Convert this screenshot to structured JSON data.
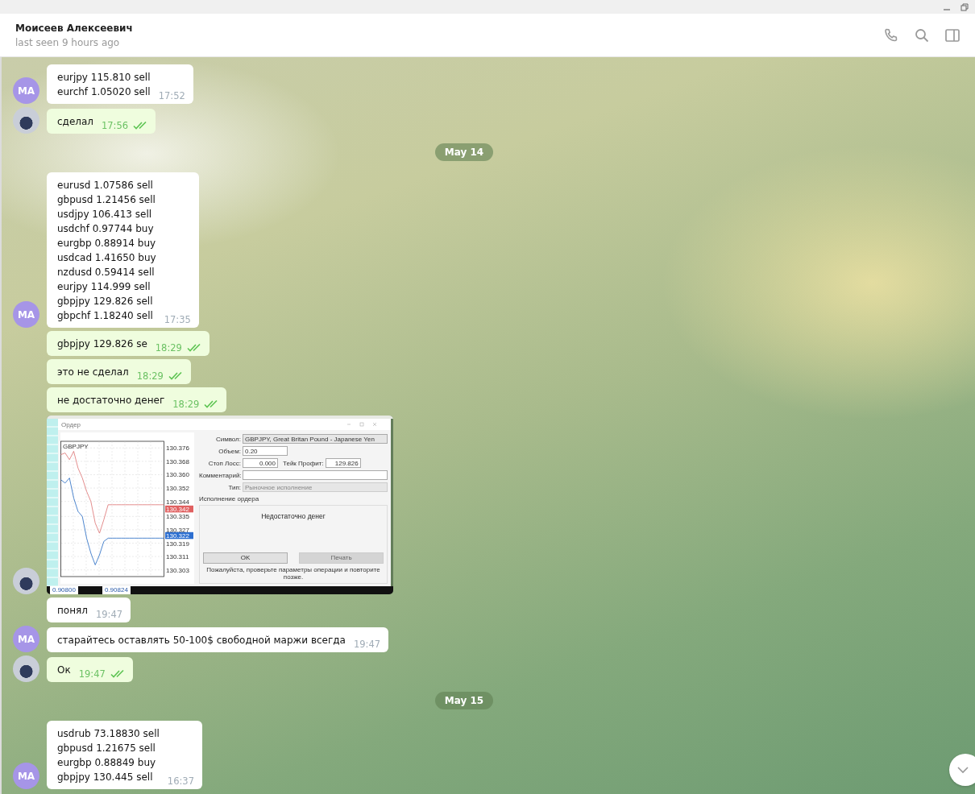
{
  "header": {
    "name": "Моисеев Алексеевич",
    "status": "last seen 9 hours ago"
  },
  "messages": [
    {
      "kind": "message",
      "outgoing": false,
      "avatar": {
        "kind": "initials",
        "initials": "MA"
      },
      "lines": [
        "eurjpy 115.810 sell",
        "eurchf 1.05020 sell"
      ],
      "time": "17:52"
    },
    {
      "kind": "message",
      "outgoing": true,
      "avatar": {
        "kind": "photo"
      },
      "lines": [
        "сделал"
      ],
      "time": "17:56",
      "read": true
    },
    {
      "kind": "date",
      "label": "May 14"
    },
    {
      "kind": "message",
      "outgoing": false,
      "avatar": {
        "kind": "initials",
        "initials": "MA"
      },
      "lines": [
        "eurusd 1.07586 sell",
        "gbpusd 1.21456 sell",
        "usdjpy 106.413 sell",
        "usdchf 0.97744 buy",
        "eurgbp 0.88914 buy",
        "usdcad 1.41650 buy",
        "nzdusd 0.59414 sell",
        "eurjpy 114.999 sell",
        "gbpjpy 129.826 sell",
        "gbpchf 1.18240 sell"
      ],
      "time": "17:35"
    },
    {
      "kind": "message",
      "outgoing": true,
      "lines": [
        "gbpjpy 129.826 se"
      ],
      "time": "18:29",
      "read": true
    },
    {
      "kind": "message",
      "outgoing": true,
      "lines": [
        "это не сделал"
      ],
      "time": "18:29",
      "read": true
    },
    {
      "kind": "message",
      "outgoing": true,
      "lines": [
        "не достаточно денег"
      ],
      "time": "18:29",
      "read": true
    },
    {
      "kind": "image",
      "outgoing": true,
      "avatar": {
        "kind": "photo"
      },
      "shot": {
        "window_title": "Ордер",
        "chart_symbol": "GBPJPY",
        "chart_data": {
          "type": "line",
          "grid": true,
          "ylim": [
            130.299,
            130.38
          ],
          "yticks": [
            130.376,
            130.368,
            {
              "value": 130.36,
              "label": "130.360"
            },
            130.352,
            130.344,
            130.335,
            130.327,
            130.319,
            130.311,
            130.303
          ],
          "series": [
            {
              "color": "#e08080",
              "values": [
                130.372,
                130.373,
                130.369,
                130.374,
                130.364,
                130.358,
                130.35,
                130.344,
                130.331,
                130.325,
                130.333,
                130.342,
                130.342,
                130.342,
                130.342,
                130.342,
                130.342,
                130.342,
                130.342,
                130.342,
                130.342,
                130.342,
                130.342,
                130.342,
                130.342
              ]
            },
            {
              "color": "#3a78c8",
              "values": [
                130.357,
                130.355,
                130.358,
                130.346,
                130.338,
                130.335,
                130.322,
                130.313,
                130.306,
                130.312,
                130.32,
                130.322,
                130.322,
                130.322,
                130.322,
                130.322,
                130.322,
                130.322,
                130.322,
                130.322,
                130.322,
                130.322,
                130.322,
                130.322,
                130.322
              ]
            }
          ]
        },
        "ask_tag": "130.342",
        "bid_tag": "130.322",
        "bottom_values": [
          "0.90800",
          "0.90824"
        ],
        "symbol_label": "Символ:",
        "symbol_value": "GBPJPY, Great Britan Pound - Japanese Yen",
        "volume_label": "Объем:",
        "volume_value": "0.20",
        "sl_label": "Стоп Лосс:",
        "sl_value": "0.000",
        "tp_label": "Тейк Профит:",
        "tp_value": "129.826",
        "comment_label": "Комментарий:",
        "type_label": "Тип:",
        "type_value": "Рыночное исполнение",
        "group_label": "Исполнение ордера",
        "error": "Недостаточно денег",
        "ok": "OK",
        "print": "Печать",
        "note": "Пожалуйста, проверьте параметры операции и повторите позже."
      }
    },
    {
      "kind": "message",
      "outgoing": false,
      "lines": [
        "понял"
      ],
      "time": "19:47"
    },
    {
      "kind": "message",
      "outgoing": false,
      "avatar": {
        "kind": "initials",
        "initials": "MA"
      },
      "lines": [
        "старайтесь оставлять 50-100$ свободной маржи всегда"
      ],
      "time": "19:47"
    },
    {
      "kind": "message",
      "outgoing": true,
      "avatar": {
        "kind": "photo"
      },
      "lines": [
        "Ок"
      ],
      "time": "19:47",
      "read": true
    },
    {
      "kind": "date",
      "label": "May 15"
    },
    {
      "kind": "message",
      "outgoing": false,
      "avatar": {
        "kind": "initials",
        "initials": "MA"
      },
      "lines": [
        "usdrub 73.18830 sell",
        "gbpusd 1.21675 sell",
        "eurgbp 0.88849 buy",
        "gbpjpy 130.445 sell"
      ],
      "time": "16:37"
    }
  ]
}
